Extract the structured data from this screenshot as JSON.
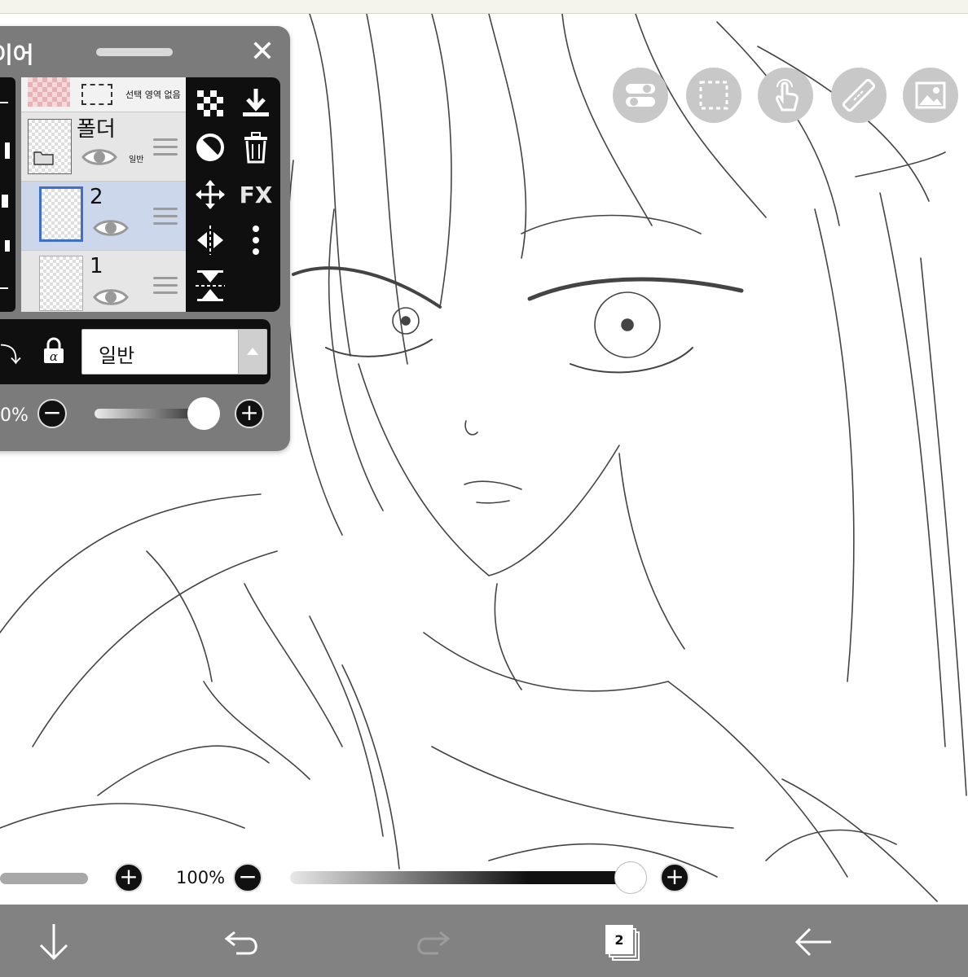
{
  "layer_panel": {
    "title": "이어",
    "close_label": "✕",
    "selection_text": "선택 영역 없음",
    "layers": [
      {
        "name": "폴더",
        "blend": "일반",
        "type": "folder",
        "selected": false
      },
      {
        "name": "2",
        "blend": "",
        "type": "layer",
        "selected": true
      },
      {
        "name": "1",
        "blend": "",
        "type": "layer",
        "selected": false
      }
    ],
    "tools": {
      "fx_label": "FX",
      "icons": [
        "checker-icon",
        "merge-down-icon",
        "half-circle-icon",
        "trash-icon",
        "move-icon",
        "fx-icon",
        "flip-horizontal-icon",
        "more-icon",
        "flip-vertical-icon"
      ]
    },
    "blend_mode": "일반",
    "opacity_label": "0%"
  },
  "quick_tools": [
    "toggle-icon",
    "selection-icon",
    "touch-icon",
    "ruler-icon",
    "image-icon"
  ],
  "brush": {
    "opacity_label": "100%"
  },
  "bottom_nav": {
    "layers_count": "2",
    "icons": [
      "download-arrow-icon",
      "undo-icon",
      "redo-icon",
      "layers-icon",
      "back-icon"
    ]
  },
  "colors": {
    "panel": "#7b7b7b",
    "toolbar_dark": "#0f0f0f",
    "selected_row": "#ccd7ec",
    "selected_border": "#3e6fc4",
    "bottom_bar": "#828282"
  }
}
